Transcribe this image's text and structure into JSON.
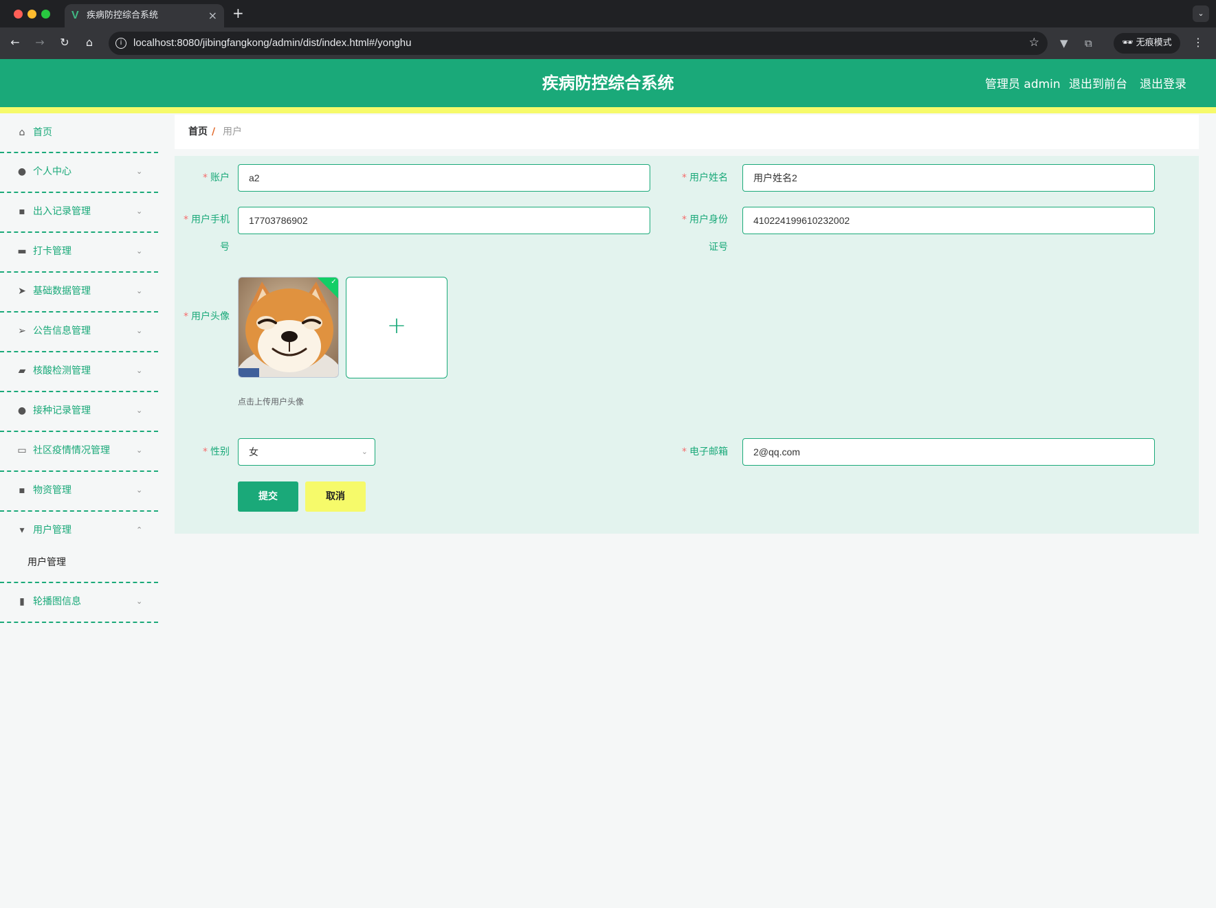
{
  "browser": {
    "tab_title": "疾病防控综合系统",
    "tab_icon": "vue-logo-icon",
    "url": "localhost:8080/jibingfangkong/admin/dist/index.html#/yonghu",
    "incognito_label": "无痕模式"
  },
  "header": {
    "title": "疾病防控综合系统",
    "admin_label": "管理员 admin",
    "back_to_front": "退出到前台",
    "logout": "退出登录"
  },
  "sidebar": {
    "items": [
      {
        "label": "首页",
        "icon": "home-icon"
      },
      {
        "label": "个人中心",
        "icon": "user-icon"
      },
      {
        "label": "出入记录管理",
        "icon": "printer-icon"
      },
      {
        "label": "打卡管理",
        "icon": "wallet-icon"
      },
      {
        "label": "基础数据管理",
        "icon": "send-icon"
      },
      {
        "label": "公告信息管理",
        "icon": "position-icon"
      },
      {
        "label": "核酸检测管理",
        "icon": "briefcase-icon"
      },
      {
        "label": "接种记录管理",
        "icon": "user-icon"
      },
      {
        "label": "社区疫情情况管理",
        "icon": "chat-icon"
      },
      {
        "label": "物资管理",
        "icon": "message-icon"
      },
      {
        "label": "用户管理",
        "icon": "stamp-icon"
      },
      {
        "label": "轮播图信息",
        "icon": "chart-icon"
      }
    ],
    "submenu": {
      "label": "用户管理"
    }
  },
  "breadcrumb": {
    "home": "首页",
    "separator": "/",
    "current": "用户"
  },
  "form": {
    "account": {
      "label": "账户",
      "value": "a2"
    },
    "name": {
      "label": "用户姓名",
      "value": "用户姓名2"
    },
    "phone": {
      "label_line1": "用户手机",
      "label_line2": "号",
      "value": "17703786902"
    },
    "idcard": {
      "label_line1": "用户身份",
      "label_line2": "证号",
      "value": "410224199610232002"
    },
    "avatar": {
      "label": "用户头像",
      "tip": "点击上传用户头像",
      "upload_icon": "plus-icon"
    },
    "gender": {
      "label": "性别",
      "value": "女"
    },
    "email": {
      "label": "电子邮箱",
      "value": "2@qq.com"
    },
    "required_mark": "*",
    "submit": "提交",
    "cancel": "取消"
  },
  "colors": {
    "primary": "#1aa979",
    "accent_yellow": "#f6fa6a",
    "panel_bg": "#e3f3ee",
    "required": "#f56c6c"
  }
}
